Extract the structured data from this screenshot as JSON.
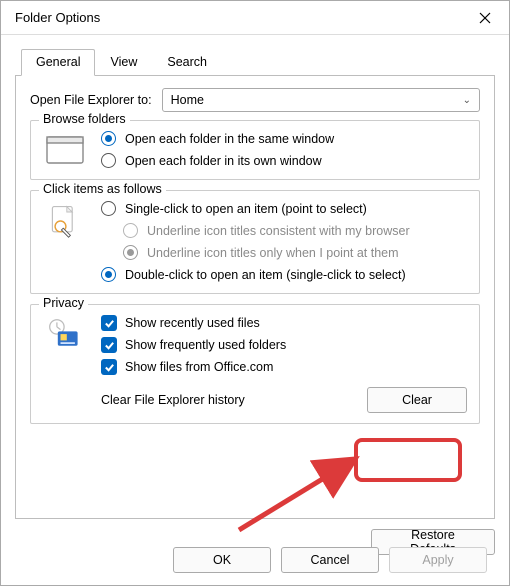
{
  "title": "Folder Options",
  "tabs": {
    "general": "General",
    "view": "View",
    "search": "Search"
  },
  "open_explorer": {
    "label": "Open File Explorer to:",
    "value": "Home"
  },
  "browse": {
    "legend": "Browse folders",
    "same_window": "Open each folder in the same window",
    "own_window": "Open each folder in its own window"
  },
  "click": {
    "legend": "Click items as follows",
    "single": "Single-click to open an item (point to select)",
    "underline_browser": "Underline icon titles consistent with my browser",
    "underline_point": "Underline icon titles only when I point at them",
    "double": "Double-click to open an item (single-click to select)"
  },
  "privacy": {
    "legend": "Privacy",
    "recent_files": "Show recently used files",
    "frequent_folders": "Show frequently used folders",
    "office": "Show files from Office.com",
    "clear_label": "Clear File Explorer history",
    "clear_button": "Clear"
  },
  "restore_defaults": "Restore Defaults",
  "footer": {
    "ok": "OK",
    "cancel": "Cancel",
    "apply": "Apply"
  }
}
